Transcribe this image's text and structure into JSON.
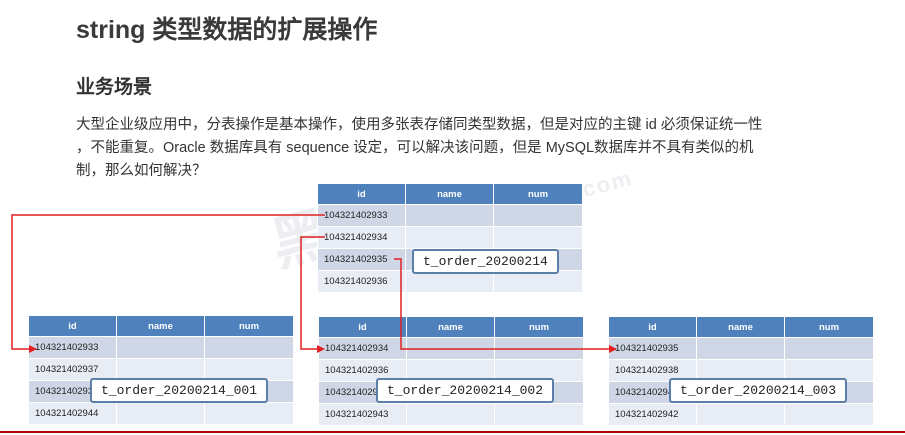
{
  "title": "string 类型数据的扩展操作",
  "section": "业务场景",
  "description": [
    "大型企业级应用中，分表操作是基本操作，使用多张表存储同类型数据，但是对应的主键 id 必须保证统一性",
    "，不能重复。Oracle 数据库具有 sequence 设定，可以解决该问题，但是 MySQL数据库并不具有类似的机",
    "制，那么如何解决？"
  ],
  "tables": {
    "main": {
      "label": "t_order_20200214",
      "headers": [
        "id",
        "name",
        "num"
      ],
      "rows": [
        [
          "104321402933",
          "",
          ""
        ],
        [
          "104321402934",
          "",
          ""
        ],
        [
          "104321402935",
          "",
          ""
        ],
        [
          "104321402936",
          "",
          ""
        ]
      ]
    },
    "t001": {
      "label": "t_order_20200214_001",
      "headers": [
        "id",
        "name",
        "num"
      ],
      "rows": [
        [
          "104321402933",
          "",
          ""
        ],
        [
          "104321402937",
          "",
          ""
        ],
        [
          "104321402939",
          "",
          ""
        ],
        [
          "104321402944",
          "",
          ""
        ]
      ]
    },
    "t002": {
      "label": "t_order_20200214_002",
      "headers": [
        "id",
        "name",
        "num"
      ],
      "rows": [
        [
          "104321402934",
          "",
          ""
        ],
        [
          "104321402936",
          "",
          ""
        ],
        [
          "104321402940",
          "",
          ""
        ],
        [
          "104321402943",
          "",
          ""
        ]
      ]
    },
    "t003": {
      "label": "t_order_20200214_003",
      "headers": [
        "id",
        "name",
        "num"
      ],
      "rows": [
        [
          "104321402935",
          "",
          ""
        ],
        [
          "104321402938",
          "",
          ""
        ],
        [
          "104321402941",
          "",
          ""
        ],
        [
          "104321402942",
          "",
          ""
        ]
      ]
    }
  },
  "colors": {
    "header": "#4f81bd",
    "row_odd": "#cfd7e6",
    "row_even": "#e8ecf4",
    "arrow": "#e02020"
  }
}
